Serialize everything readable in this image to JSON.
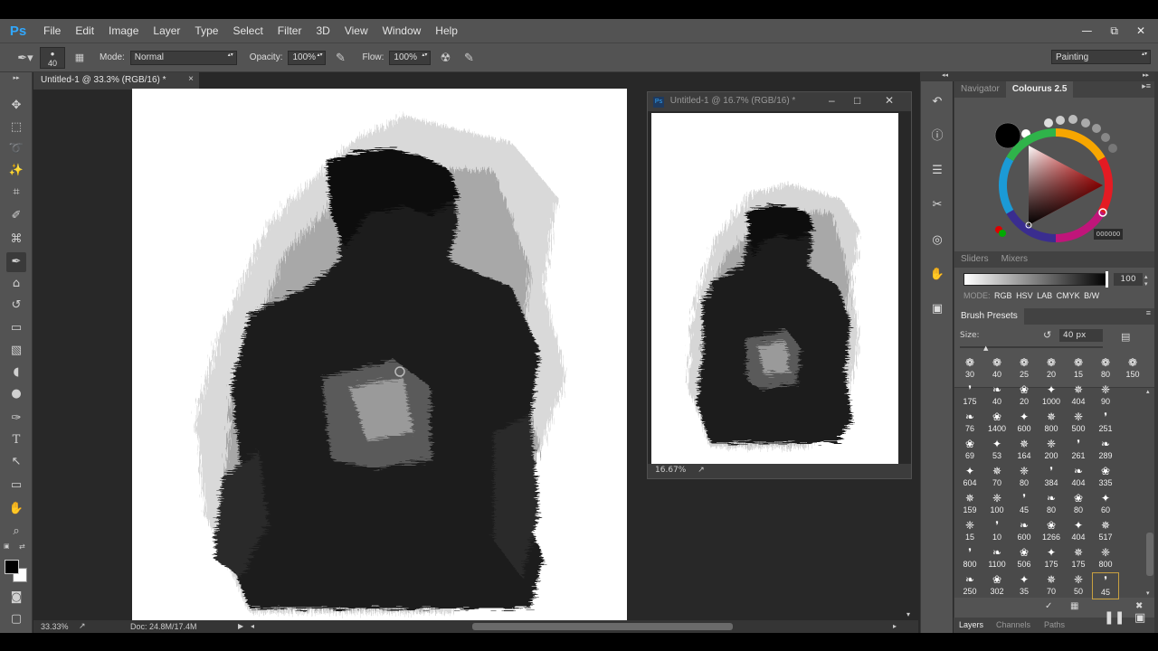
{
  "app": {
    "logo": "Ps"
  },
  "menu": [
    "File",
    "Edit",
    "Image",
    "Layer",
    "Type",
    "Select",
    "Filter",
    "3D",
    "View",
    "Window",
    "Help"
  ],
  "window_controls": {
    "minimize": "—",
    "restore": "⧉",
    "close": "✕"
  },
  "options": {
    "brush_size": "40",
    "mode_label": "Mode:",
    "mode_value": "Normal",
    "opacity_label": "Opacity:",
    "opacity_value": "100%",
    "flow_label": "Flow:",
    "flow_value": "100%",
    "workspace": "Painting"
  },
  "document": {
    "tab_title": "Untitled-1 @ 33.3% (RGB/16) *",
    "close": "×",
    "zoom": "33.33%",
    "doc_info": "Doc: 24.8M/17.4M"
  },
  "second_window": {
    "title": "Untitled-1 @ 16.7% (RGB/16) *",
    "zoom": "16.67%"
  },
  "panels": {
    "tab_navigator": "Navigator",
    "tab_colours": "Colourus 2.5",
    "hex_value": "000000",
    "tab_sliders": "Sliders",
    "tab_mixers": "Mixers",
    "slider_value": "100",
    "modes": [
      "MODE:",
      "RGB",
      "HSV",
      "LAB",
      "CMYK",
      "B/W"
    ],
    "brush_presets_title": "Brush Presets",
    "size_label": "Size:",
    "size_value": "40 px",
    "preset_sizes_top": [
      "30",
      "40",
      "25",
      "20",
      "15",
      "80",
      "150"
    ],
    "brush_rows": [
      [
        "175",
        "40",
        "20",
        "1000",
        "404",
        "90"
      ],
      [
        "76",
        "1400",
        "600",
        "800",
        "500",
        "251"
      ],
      [
        "69",
        "53",
        "164",
        "200",
        "261",
        "289"
      ],
      [
        "604",
        "70",
        "80",
        "384",
        "404",
        "335"
      ],
      [
        "159",
        "100",
        "45",
        "80",
        "80",
        "60"
      ],
      [
        "15",
        "10",
        "600",
        "1266",
        "404",
        "517"
      ],
      [
        "800",
        "1100",
        "506",
        "175",
        "175",
        "800"
      ],
      [
        "250",
        "302",
        "35",
        "70",
        "50",
        "45"
      ]
    ],
    "bottom_tabs": [
      "Layers",
      "Channels",
      "Paths"
    ]
  }
}
